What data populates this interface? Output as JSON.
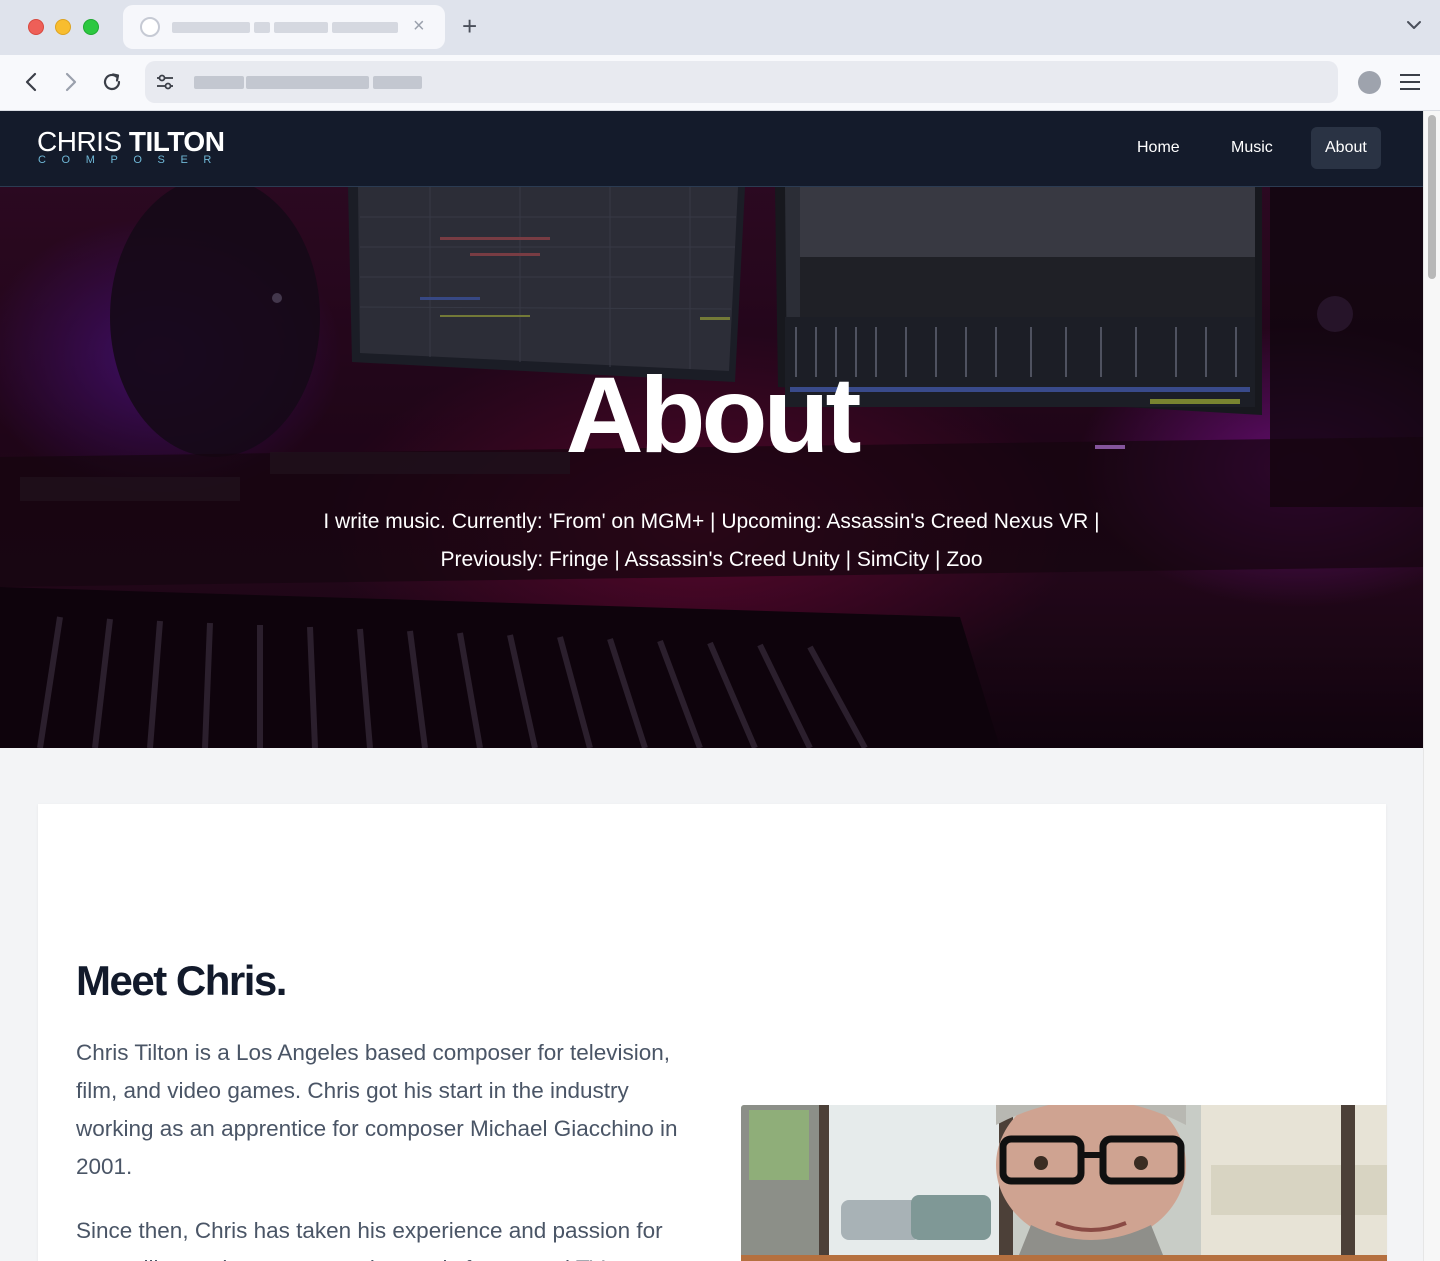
{
  "browser": {
    "tab_close_glyph": "×",
    "new_tab_glyph": "+",
    "icons": [
      "back-icon",
      "forward-icon",
      "reload-icon",
      "site-settings-icon",
      "profile-icon",
      "menu-icon",
      "tab-list-chevron-icon"
    ]
  },
  "site": {
    "logo_light": "CHRIS ",
    "logo_bold": "TILTON",
    "logo_sub": "COMPOSER",
    "nav": [
      {
        "label": "Home"
      },
      {
        "label": "Music"
      },
      {
        "label": "About",
        "active": true
      }
    ]
  },
  "hero": {
    "title": "About",
    "subtitle_line1": "I write music. Currently: 'From' on MGM+ | Upcoming: Assassin's Creed Nexus VR |",
    "subtitle_line2": "Previously: Fringe | Assassin's Creed Unity | SimCity | Zoo"
  },
  "meet": {
    "title": "Meet Chris.",
    "para1": "Chris Tilton is a Los Angeles based composer for television, film, and video games. Chris got his start in the industry working as an apprentice for composer Michael Giacchino in 2001.",
    "para2": "Since then, Chris has taken his experience and passion for storytelling and gone on to write music for several TV"
  },
  "colors": {
    "nav_bg": "#141b2b",
    "logo_accent": "#6fb7d6",
    "heading": "#121a2b",
    "body_text": "#4a5566"
  }
}
